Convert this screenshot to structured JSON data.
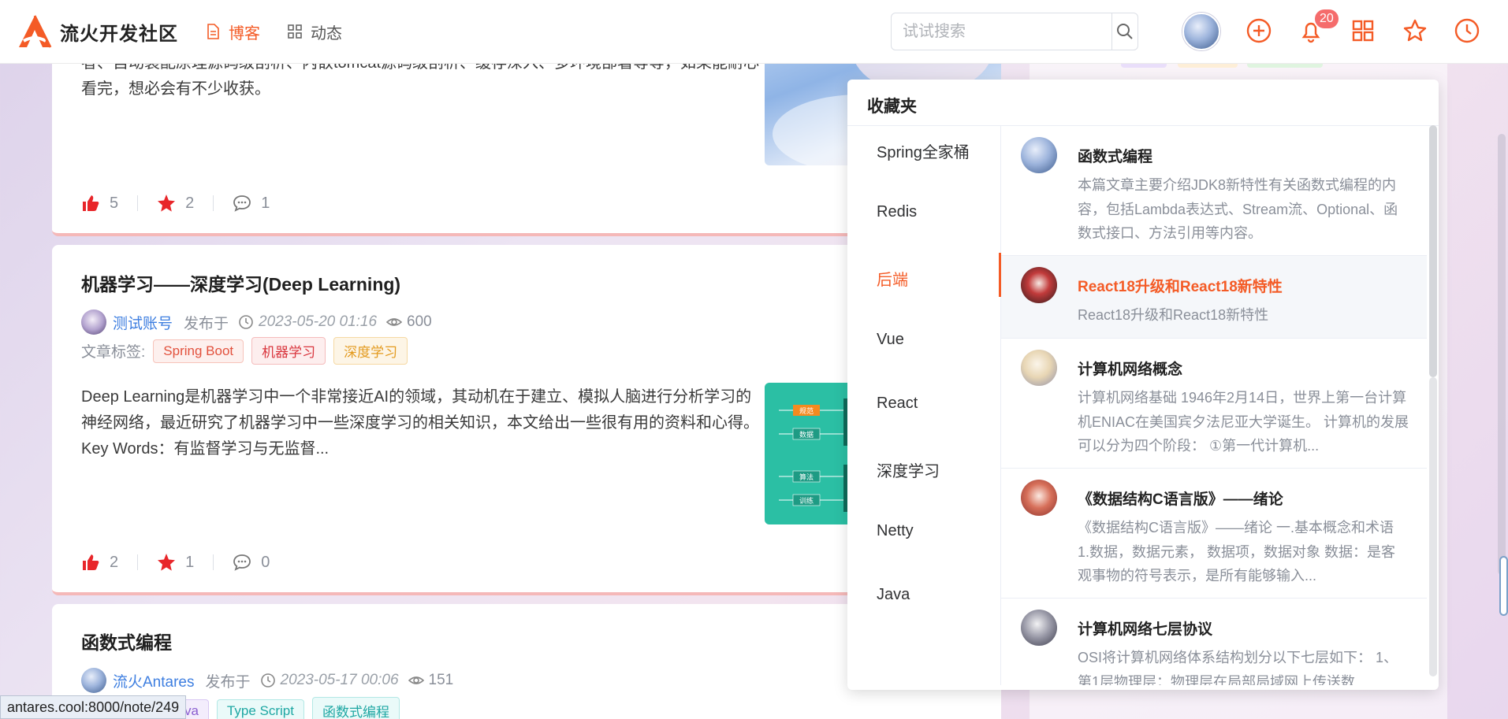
{
  "nav": {
    "brand": "流火开发社区",
    "links": [
      {
        "label": "博客",
        "active": true
      },
      {
        "label": "动态",
        "active": false
      }
    ],
    "search_placeholder": "试试搜索",
    "notification_count": "20",
    "icons": [
      "plus-circle-icon",
      "bell-icon",
      "grid-icon",
      "star-icon",
      "clock-icon"
    ]
  },
  "articles": [
    {
      "partial_text": "者、自动装配原理源码级剖析、内嵌tomcat源码级剖析、缓存深入、多环境部署等等，如果能耐心看完，想必会有不少收获。",
      "likes": "5",
      "stars": "2",
      "comments": "1"
    },
    {
      "title": "机器学习——深度学习(Deep Learning)",
      "author": "测试账号",
      "published_label": "发布于",
      "date": "2023-05-20 01:16",
      "views": "600",
      "tags_label": "文章标签:",
      "tags": [
        "Spring Boot",
        "机器学习",
        "深度学习"
      ],
      "summary": "Deep Learning是机器学习中一个非常接近AI的领域，其动机在于建立、模拟人脑进行分析学习的神经网络，最近研究了机器学习中一些深度学习的相关知识，本文给出一些很有用的资料和心得。Key Words：有监督学习与无监督...",
      "thumb_labels": [
        "规范",
        "数据",
        "算法",
        "训练"
      ],
      "likes": "2",
      "stars": "1",
      "comments": "0"
    },
    {
      "title": "函数式编程",
      "author": "流火Antares",
      "published_label": "发布于",
      "date": "2023-05-17 00:06",
      "views": "151",
      "tags": [
        "Java",
        "Type Script",
        "函数式编程"
      ]
    }
  ],
  "favorites": {
    "title": "收藏夹",
    "folders": [
      {
        "label": "Spring全家桶",
        "active": false
      },
      {
        "label": "Redis",
        "active": false
      },
      {
        "label": "后端",
        "active": true
      },
      {
        "label": "Vue",
        "active": false
      },
      {
        "label": "React",
        "active": false
      },
      {
        "label": "深度学习",
        "active": false
      },
      {
        "label": "Netty",
        "active": false
      },
      {
        "label": "Java",
        "active": false
      }
    ],
    "items": [
      {
        "title": "函数式编程",
        "desc": "本篇文章主要介绍JDK8新特性有关函数式编程的内容，包括Lambda表达式、Stream流、Optional、函数式接口、方法引用等内容。",
        "active": false
      },
      {
        "title": "React18升级和React18新特性",
        "desc": "React18升级和React18新特性",
        "active": true
      },
      {
        "title": "计算机网络概念",
        "desc": "计算机网络基础 1946年2月14日，世界上第一台计算机ENIAC在美国宾夕法尼亚大学诞生。 计算机的发展可以分为四个阶段： ①第一代计算机...",
        "active": false
      },
      {
        "title": "《数据结构C语言版》——绪论",
        "desc": "《数据结构C语言版》——绪论 一.基本概念和术语 1.数据，数据元素， 数据项，数据对象 数据：是客观事物的符号表示，是所有能够输入...",
        "active": false
      },
      {
        "title": "计算机网络七层协议",
        "desc": "OSI将计算机网络体系结构划分以下七层如下： 1、第1层物理层：物理层在局部局域网上传送数",
        "active": false
      }
    ]
  },
  "status_url": "antares.cool:8000/note/249",
  "colors": {
    "accent": "#f45b26",
    "author_link": "#3d7ee0",
    "like_red": "#e8262a"
  }
}
